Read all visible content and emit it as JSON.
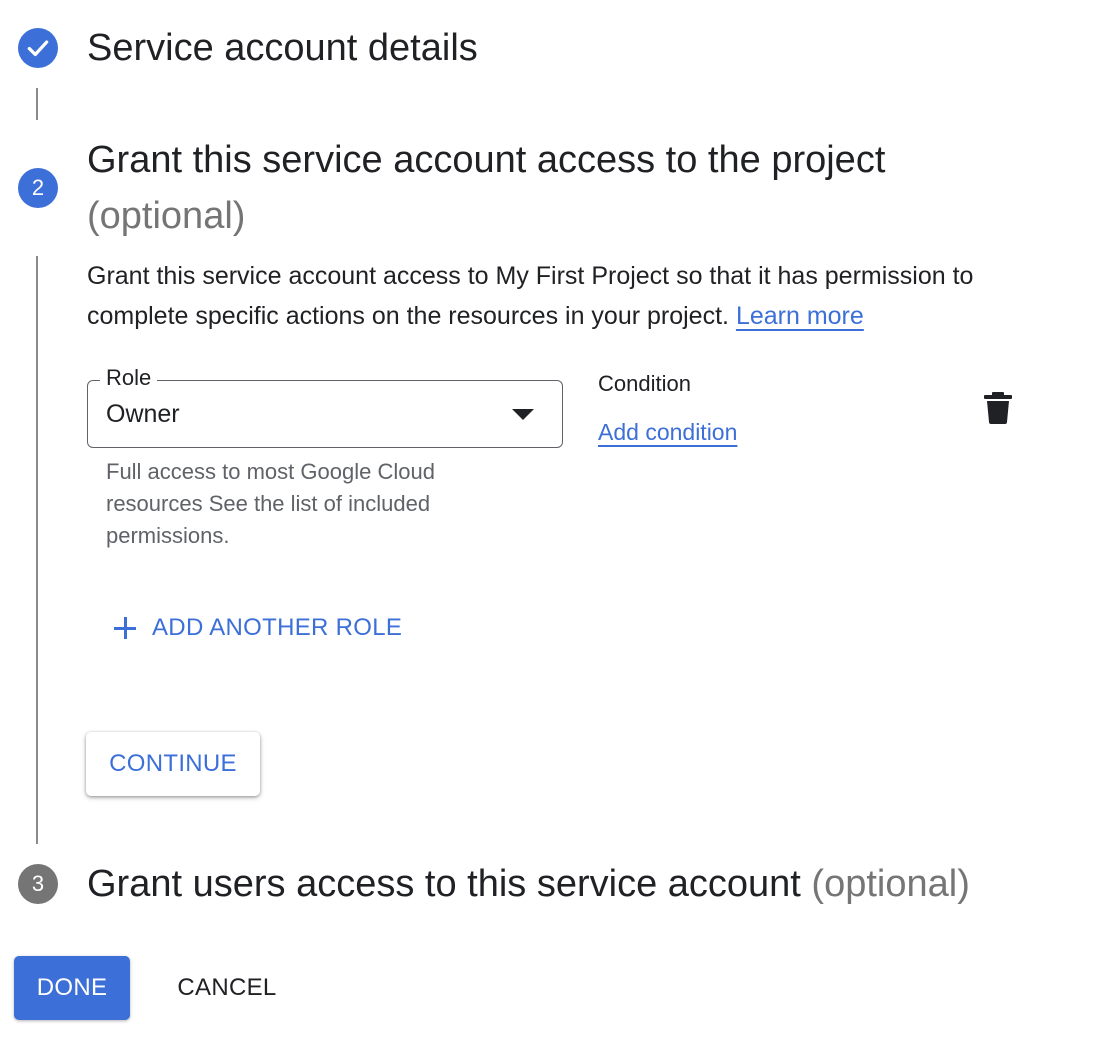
{
  "steps": [
    {
      "number": "",
      "status": "completed",
      "icon": "check-icon",
      "title": "Service account details"
    },
    {
      "number": "2",
      "status": "active",
      "title": "Grant this service account access to the project",
      "optional": "(optional)",
      "description": "Grant this service account access to My First Project so that it has permission to complete specific actions on the resources in your project.",
      "learn_more": "Learn more",
      "role": {
        "label": "Role",
        "value": "Owner",
        "hint": "Full access to most Google Cloud resources See the list of included permissions."
      },
      "condition": {
        "label": "Condition",
        "add_link": "Add condition"
      },
      "delete_icon": "trash-icon",
      "add_role_label": "ADD ANOTHER ROLE",
      "continue_label": "CONTINUE"
    },
    {
      "number": "3",
      "status": "inactive",
      "title": "Grant users access to this service account",
      "optional": "(optional)"
    }
  ],
  "footer": {
    "done_label": "DONE",
    "cancel_label": "CANCEL"
  },
  "colors": {
    "accent": "#3c6fd8",
    "inactive_step": "#757575",
    "text": "#202124",
    "muted_text": "#5f6368"
  }
}
